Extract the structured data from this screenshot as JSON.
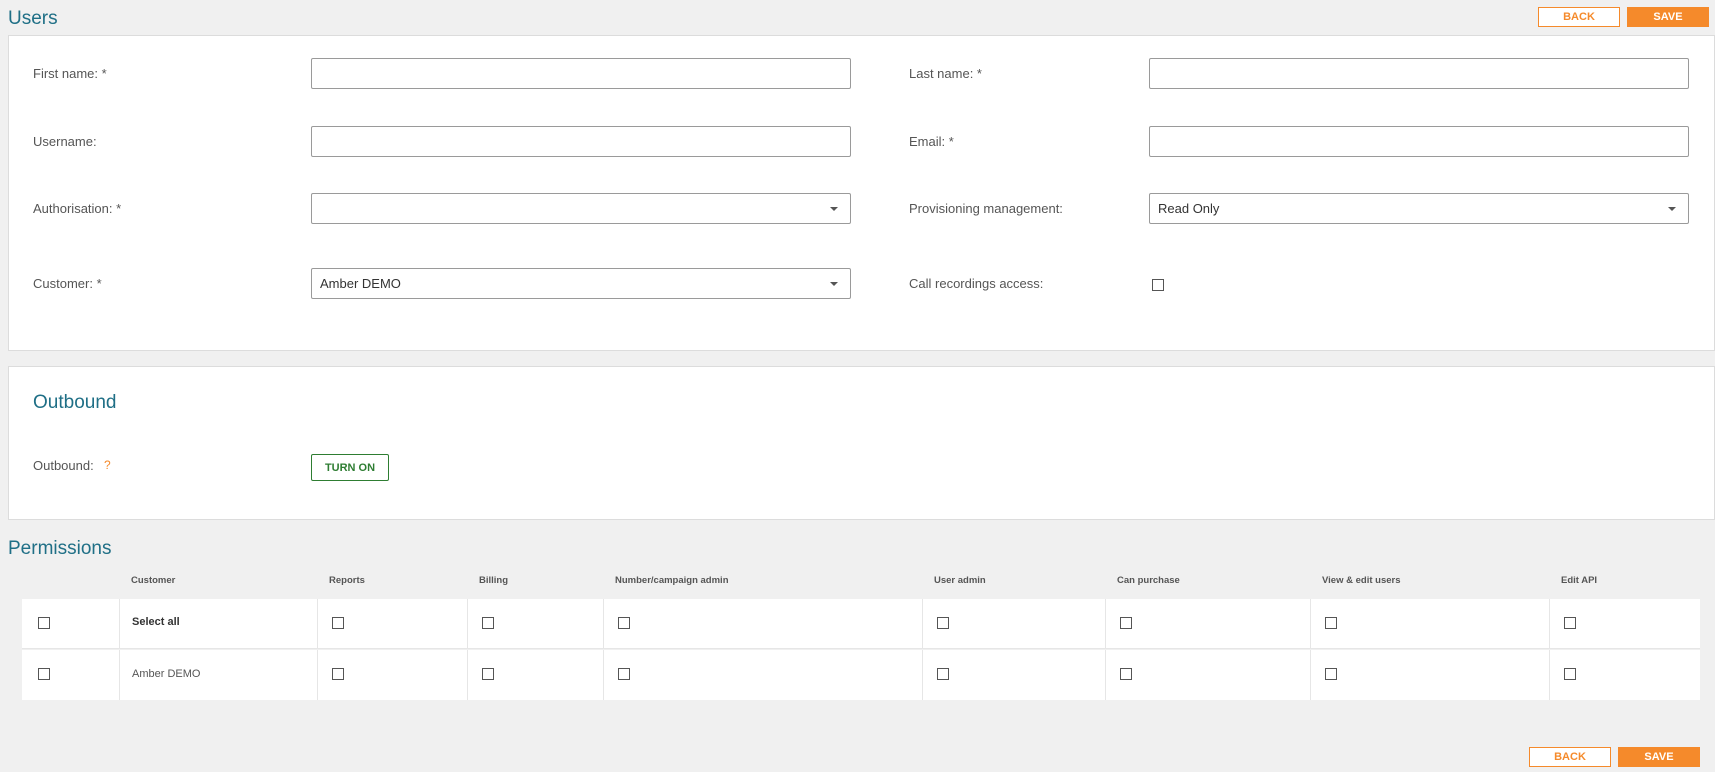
{
  "header": {
    "title": "Users",
    "back_label": "BACK",
    "save_label": "SAVE"
  },
  "form": {
    "first_name": {
      "label": "First name: *",
      "value": ""
    },
    "last_name": {
      "label": "Last name: *",
      "value": ""
    },
    "username": {
      "label": "Username:",
      "value": ""
    },
    "email": {
      "label": "Email: *",
      "value": ""
    },
    "authorisation": {
      "label": "Authorisation: *",
      "value": ""
    },
    "provisioning": {
      "label": "Provisioning management:",
      "value": "Read Only"
    },
    "customer": {
      "label": "Customer: *",
      "value": "Amber DEMO"
    },
    "call_recordings": {
      "label": "Call recordings access:",
      "checked": false
    }
  },
  "outbound": {
    "title": "Outbound",
    "label": "Outbound:",
    "help": "?",
    "button_label": "TURN ON"
  },
  "permissions": {
    "title": "Permissions",
    "columns": [
      "Customer",
      "Reports",
      "Billing",
      "Number/campaign admin",
      "User admin",
      "Can purchase",
      "View & edit users",
      "Edit API"
    ],
    "rows": [
      {
        "customer": "Select all",
        "bold": true
      },
      {
        "customer": "Amber DEMO",
        "bold": false
      }
    ]
  },
  "footer": {
    "back_label": "BACK",
    "save_label": "SAVE"
  },
  "colors": {
    "accent": "#f58a2b",
    "title": "#1f6f86",
    "turn_on": "#2e7d32"
  }
}
